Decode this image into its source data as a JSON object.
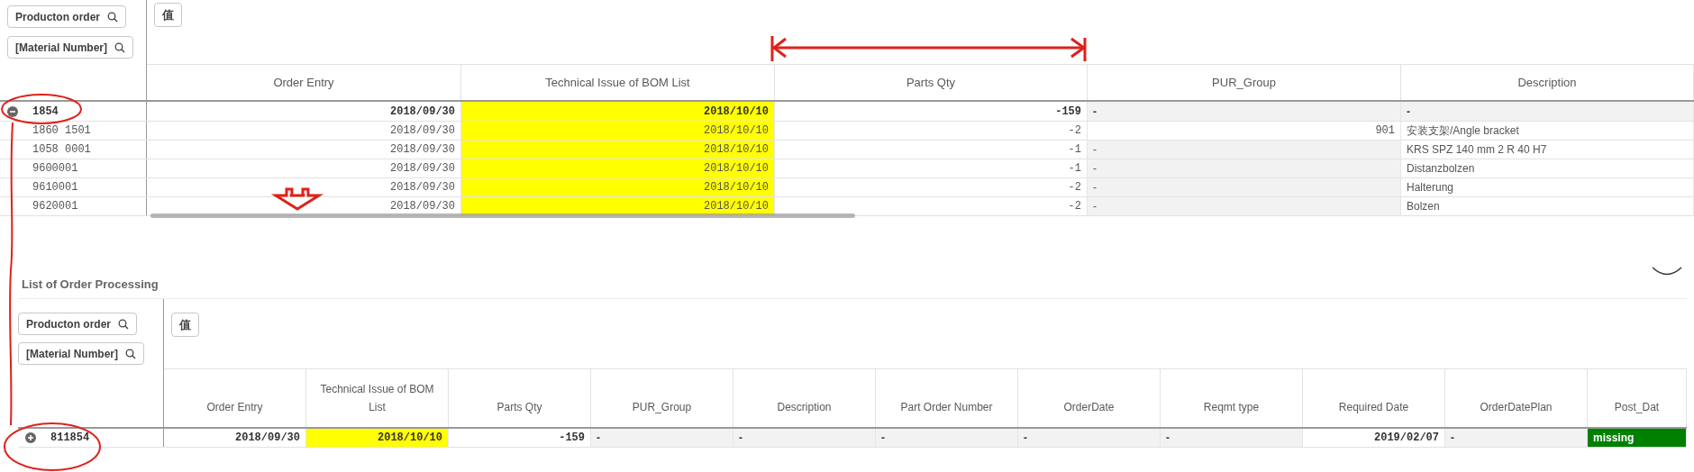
{
  "top_table": {
    "filters": [
      "Producton order",
      "[Material Number]"
    ],
    "values_button": "值",
    "columns": [
      "Order Entry",
      "Technical Issue of BOM List",
      "Parts Qty",
      "PUR_Group",
      "Description"
    ],
    "rows": [
      {
        "label": "1854",
        "expanded": true,
        "total": true,
        "cells": [
          {
            "text": "2018/09/30",
            "kind": "number"
          },
          {
            "text": "2018/10/10",
            "kind": "highlight"
          },
          {
            "text": "-159",
            "kind": "number"
          },
          {
            "text": "-",
            "kind": "empty"
          },
          {
            "text": "-",
            "kind": "empty"
          }
        ]
      },
      {
        "label": "1860 1501",
        "total": false,
        "cells": [
          {
            "text": "2018/09/30",
            "kind": "number"
          },
          {
            "text": "2018/10/10",
            "kind": "highlight"
          },
          {
            "text": "-2",
            "kind": "number"
          },
          {
            "text": "901",
            "kind": "number"
          },
          {
            "text": "安装支架/Angle bracket",
            "kind": "text"
          }
        ]
      },
      {
        "label": "1058 0001",
        "total": false,
        "cells": [
          {
            "text": "2018/09/30",
            "kind": "number"
          },
          {
            "text": "2018/10/10",
            "kind": "highlight"
          },
          {
            "text": "-1",
            "kind": "number"
          },
          {
            "text": "-",
            "kind": "empty"
          },
          {
            "text": "KRS SPZ 140 mm 2 R 40 H7",
            "kind": "text"
          }
        ]
      },
      {
        "label": "9600001",
        "total": false,
        "cells": [
          {
            "text": "2018/09/30",
            "kind": "number"
          },
          {
            "text": "2018/10/10",
            "kind": "highlight"
          },
          {
            "text": "-1",
            "kind": "number"
          },
          {
            "text": "-",
            "kind": "empty"
          },
          {
            "text": "Distanzbolzen",
            "kind": "text"
          }
        ]
      },
      {
        "label": "9610001",
        "total": false,
        "cells": [
          {
            "text": "2018/09/30",
            "kind": "number"
          },
          {
            "text": "2018/10/10",
            "kind": "highlight"
          },
          {
            "text": "-2",
            "kind": "number"
          },
          {
            "text": "-",
            "kind": "empty"
          },
          {
            "text": "Halterung",
            "kind": "text"
          }
        ]
      },
      {
        "label": "9620001",
        "total": false,
        "cells": [
          {
            "text": "2018/09/30",
            "kind": "number"
          },
          {
            "text": "2018/10/10",
            "kind": "highlight"
          },
          {
            "text": "-2",
            "kind": "number"
          },
          {
            "text": "-",
            "kind": "empty"
          },
          {
            "text": "Bolzen",
            "kind": "text"
          }
        ]
      }
    ]
  },
  "bottom_table": {
    "title": "List of Order Processing",
    "filters": [
      "Producton order",
      "[Material Number]"
    ],
    "values_button": "值",
    "columns": [
      "Order Entry",
      "Technical Issue of BOM List",
      "Parts Qty",
      "PUR_Group",
      "Description",
      "Part Order Number",
      "OrderDate",
      "Reqmt type",
      "Required Date",
      "OrderDatePlan",
      "Post_Dat"
    ],
    "rows": [
      {
        "label": "811854",
        "expanded": false,
        "total": true,
        "cells": [
          {
            "text": "2018/09/30",
            "kind": "number"
          },
          {
            "text": "2018/10/10",
            "kind": "highlight"
          },
          {
            "text": "-159",
            "kind": "number"
          },
          {
            "text": "-",
            "kind": "empty"
          },
          {
            "text": "-",
            "kind": "empty"
          },
          {
            "text": "-",
            "kind": "empty"
          },
          {
            "text": "-",
            "kind": "empty"
          },
          {
            "text": "-",
            "kind": "empty"
          },
          {
            "text": "2019/02/07",
            "kind": "number"
          },
          {
            "text": "-",
            "kind": "empty"
          },
          {
            "text": "missing",
            "kind": "alert"
          }
        ]
      }
    ]
  }
}
